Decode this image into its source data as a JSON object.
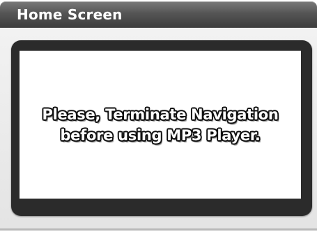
{
  "header": {
    "title": "Home Screen"
  },
  "dialog": {
    "message_line_1": "Please, Terminate Navigation",
    "message_line_2": "before using MP3 Player."
  },
  "colors": {
    "title_bar": "#555555",
    "frame": "#2b2b2b",
    "panel": "#ffffff",
    "background": "#e8e8e8"
  }
}
